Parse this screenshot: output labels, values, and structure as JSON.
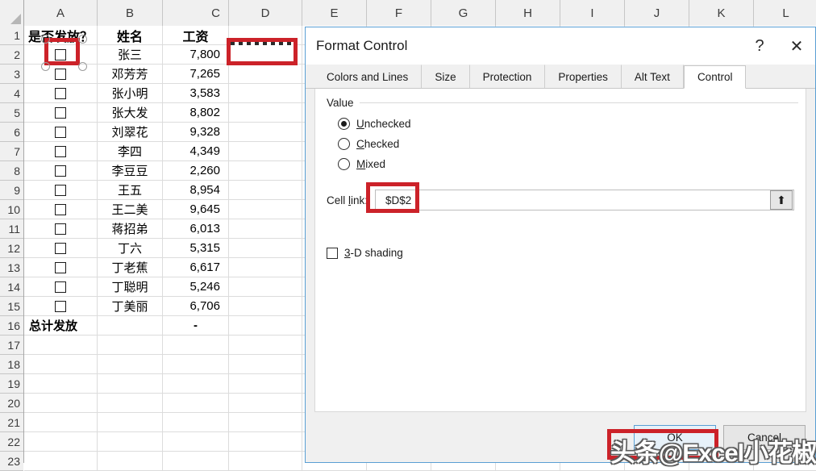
{
  "spreadsheet": {
    "columns": [
      "A",
      "B",
      "C",
      "D",
      "E",
      "F",
      "G",
      "H",
      "I",
      "J",
      "K",
      "L"
    ],
    "row_numbers": [
      "1",
      "2",
      "3",
      "4",
      "5",
      "6",
      "7",
      "8",
      "9",
      "10",
      "11",
      "12",
      "13",
      "14",
      "15",
      "16",
      "17",
      "18",
      "19",
      "20",
      "21",
      "22",
      "23"
    ],
    "headers": {
      "a": "是否发放？",
      "b": "姓名",
      "c": "工资"
    },
    "rows": [
      {
        "checkbox": true,
        "name": "张三",
        "salary": "7,800"
      },
      {
        "checkbox": true,
        "name": "邓芳芳",
        "salary": "7,265"
      },
      {
        "checkbox": true,
        "name": "张小明",
        "salary": "3,583"
      },
      {
        "checkbox": true,
        "name": "张大发",
        "salary": "8,802"
      },
      {
        "checkbox": true,
        "name": "刘翠花",
        "salary": "9,328"
      },
      {
        "checkbox": true,
        "name": "李四",
        "salary": "4,349"
      },
      {
        "checkbox": true,
        "name": "李豆豆",
        "salary": "2,260"
      },
      {
        "checkbox": true,
        "name": "王五",
        "salary": "8,954"
      },
      {
        "checkbox": true,
        "name": "王二美",
        "salary": "9,645"
      },
      {
        "checkbox": true,
        "name": "蒋招弟",
        "salary": "6,013"
      },
      {
        "checkbox": true,
        "name": "丁六",
        "salary": "5,315"
      },
      {
        "checkbox": true,
        "name": "丁老蕉",
        "salary": "6,617"
      },
      {
        "checkbox": true,
        "name": "丁聪明",
        "salary": "5,246"
      },
      {
        "checkbox": true,
        "name": "丁美丽",
        "salary": "6,706"
      }
    ],
    "total_row": {
      "label": "总计发放",
      "value": "-"
    },
    "selection_accent": "#cc2229"
  },
  "dialog": {
    "title": "Format Control",
    "help_icon": "?",
    "close_icon": "✕",
    "tabs": [
      {
        "label": "Colors and Lines",
        "active": false
      },
      {
        "label": "Size",
        "active": false
      },
      {
        "label": "Protection",
        "active": false
      },
      {
        "label": "Properties",
        "active": false
      },
      {
        "label": "Alt Text",
        "active": false
      },
      {
        "label": "Control",
        "active": true
      }
    ],
    "value_group": {
      "label": "Value",
      "options": [
        {
          "label": "Unchecked",
          "accel": "U",
          "rest": "nchecked",
          "selected": true
        },
        {
          "label": "Checked",
          "accel": "C",
          "rest": "hecked",
          "selected": false
        },
        {
          "label": "Mixed",
          "accel": "M",
          "rest": "ixed",
          "selected": false
        }
      ]
    },
    "cell_link": {
      "label_pre": "Cell ",
      "label_accel": "l",
      "label_post": "ink:",
      "value": "$D$2",
      "placeholder": "",
      "collapse_icon": "⬆"
    },
    "shading": {
      "accel": "3",
      "rest": "-D shading",
      "checked": false
    },
    "buttons": [
      {
        "label": "OK",
        "default": true
      },
      {
        "label": "Cancel",
        "default": false
      }
    ]
  },
  "watermark": {
    "text": "头条@Excel小花椒"
  }
}
